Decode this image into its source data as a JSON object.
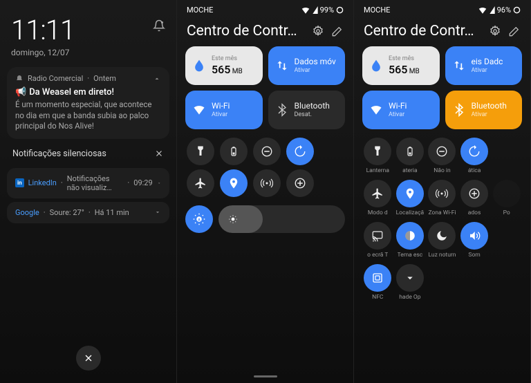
{
  "screen1": {
    "time": "11:11",
    "date": "domingo, 12/07",
    "notif1": {
      "app": "Radio Comercial",
      "when": "Ontem",
      "title": "Da Weasel em direto!",
      "body": "É um momento especial, que acontece no dia em que a banda subia ao palco principal do Nos Alive!"
    },
    "silent_header": "Notificações silenciosas",
    "notif_linkedin": {
      "app": "LinkedIn",
      "text": "Notificações não visualiz…",
      "time": "09:29"
    },
    "notif_google": {
      "app": "Google",
      "text": "Soure: 27°",
      "when": "Há 11 min"
    }
  },
  "screen2": {
    "carrier": "MOCHE",
    "battery": "99%",
    "title": "Centro de Contr…",
    "data_tile": {
      "label": "Este mês",
      "value": "565",
      "unit": "MB"
    },
    "mobile_tile": {
      "label": "Dados móv",
      "sub": "Ativar"
    },
    "wifi_tile": {
      "label": "Wi-Fi",
      "sub": "Ativar"
    },
    "bt_tile": {
      "label": "Bluetooth",
      "sub": "Desat."
    },
    "rounds": [
      "flashlight",
      "battery",
      "dnd",
      "rotate",
      "airplane",
      "location",
      "hotspot",
      "add"
    ]
  },
  "screen3": {
    "carrier": "MOCHE",
    "battery": "96%",
    "title": "Centro de Contr…",
    "data_tile": {
      "label": "Este mês",
      "value": "565",
      "unit": "MB"
    },
    "mobile_tile": {
      "label": "eis    Dadc",
      "sub": "Ativar"
    },
    "wifi_tile": {
      "label": "Wi-Fi",
      "sub": "Ativar"
    },
    "bt_tile": {
      "label": "Bluetooth",
      "sub": "Ativar"
    },
    "rows": [
      [
        {
          "icon": "flashlight",
          "label": "Lanterna",
          "active": false
        },
        {
          "icon": "battery",
          "label": "ateria",
          "active": false
        },
        {
          "icon": "dnd",
          "label": "Não in",
          "active": false
        },
        {
          "icon": "rotate",
          "label": "ática",
          "active": true
        },
        {
          "icon": "blank",
          "label": "",
          "active": false,
          "hidden": true
        }
      ],
      [
        {
          "icon": "airplane",
          "label": "Modo d",
          "active": false
        },
        {
          "icon": "location",
          "label": "Localizaçã",
          "active": true
        },
        {
          "icon": "hotspot",
          "label": "Zona Wi-Fi",
          "active": false
        },
        {
          "icon": "add",
          "label": "ados",
          "active": false
        },
        {
          "icon": "blank2",
          "label": "Po",
          "active": false,
          "dim": true
        }
      ],
      [
        {
          "icon": "cast",
          "label": "o ecrã    T",
          "active": false
        },
        {
          "icon": "theme",
          "label": "Tema esc",
          "active": true
        },
        {
          "icon": "night",
          "label": "Luz noturn",
          "active": false
        },
        {
          "icon": "sound",
          "label": "Som",
          "active": true
        },
        {
          "icon": "blank",
          "label": "",
          "active": false,
          "hidden": true
        }
      ],
      [
        {
          "icon": "nfc",
          "label": "NFC",
          "active": true
        },
        {
          "icon": "expand",
          "label": "hade   Op",
          "active": false
        },
        {
          "icon": "blank",
          "label": "",
          "active": false,
          "hidden": true
        },
        {
          "icon": "blank",
          "label": "",
          "active": false,
          "hidden": true
        },
        {
          "icon": "blank",
          "label": "",
          "active": false,
          "hidden": true
        }
      ]
    ]
  }
}
